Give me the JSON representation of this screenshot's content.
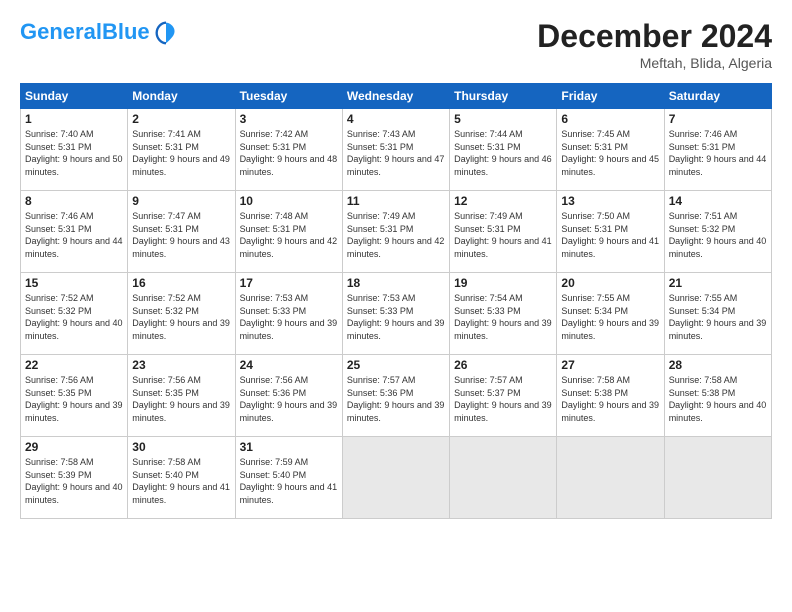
{
  "header": {
    "logo_text_general": "General",
    "logo_text_blue": "Blue",
    "month_title": "December 2024",
    "location": "Meftah, Blida, Algeria"
  },
  "weekdays": [
    "Sunday",
    "Monday",
    "Tuesday",
    "Wednesday",
    "Thursday",
    "Friday",
    "Saturday"
  ],
  "weeks": [
    [
      {
        "day": 1,
        "sunrise": "7:40 AM",
        "sunset": "5:31 PM",
        "daylight": "9 hours and 50 minutes."
      },
      {
        "day": 2,
        "sunrise": "7:41 AM",
        "sunset": "5:31 PM",
        "daylight": "9 hours and 49 minutes."
      },
      {
        "day": 3,
        "sunrise": "7:42 AM",
        "sunset": "5:31 PM",
        "daylight": "9 hours and 48 minutes."
      },
      {
        "day": 4,
        "sunrise": "7:43 AM",
        "sunset": "5:31 PM",
        "daylight": "9 hours and 47 minutes."
      },
      {
        "day": 5,
        "sunrise": "7:44 AM",
        "sunset": "5:31 PM",
        "daylight": "9 hours and 46 minutes."
      },
      {
        "day": 6,
        "sunrise": "7:45 AM",
        "sunset": "5:31 PM",
        "daylight": "9 hours and 45 minutes."
      },
      {
        "day": 7,
        "sunrise": "7:46 AM",
        "sunset": "5:31 PM",
        "daylight": "9 hours and 44 minutes."
      }
    ],
    [
      {
        "day": 8,
        "sunrise": "7:46 AM",
        "sunset": "5:31 PM",
        "daylight": "9 hours and 44 minutes."
      },
      {
        "day": 9,
        "sunrise": "7:47 AM",
        "sunset": "5:31 PM",
        "daylight": "9 hours and 43 minutes."
      },
      {
        "day": 10,
        "sunrise": "7:48 AM",
        "sunset": "5:31 PM",
        "daylight": "9 hours and 42 minutes."
      },
      {
        "day": 11,
        "sunrise": "7:49 AM",
        "sunset": "5:31 PM",
        "daylight": "9 hours and 42 minutes."
      },
      {
        "day": 12,
        "sunrise": "7:49 AM",
        "sunset": "5:31 PM",
        "daylight": "9 hours and 41 minutes."
      },
      {
        "day": 13,
        "sunrise": "7:50 AM",
        "sunset": "5:31 PM",
        "daylight": "9 hours and 41 minutes."
      },
      {
        "day": 14,
        "sunrise": "7:51 AM",
        "sunset": "5:32 PM",
        "daylight": "9 hours and 40 minutes."
      }
    ],
    [
      {
        "day": 15,
        "sunrise": "7:52 AM",
        "sunset": "5:32 PM",
        "daylight": "9 hours and 40 minutes."
      },
      {
        "day": 16,
        "sunrise": "7:52 AM",
        "sunset": "5:32 PM",
        "daylight": "9 hours and 39 minutes."
      },
      {
        "day": 17,
        "sunrise": "7:53 AM",
        "sunset": "5:33 PM",
        "daylight": "9 hours and 39 minutes."
      },
      {
        "day": 18,
        "sunrise": "7:53 AM",
        "sunset": "5:33 PM",
        "daylight": "9 hours and 39 minutes."
      },
      {
        "day": 19,
        "sunrise": "7:54 AM",
        "sunset": "5:33 PM",
        "daylight": "9 hours and 39 minutes."
      },
      {
        "day": 20,
        "sunrise": "7:55 AM",
        "sunset": "5:34 PM",
        "daylight": "9 hours and 39 minutes."
      },
      {
        "day": 21,
        "sunrise": "7:55 AM",
        "sunset": "5:34 PM",
        "daylight": "9 hours and 39 minutes."
      }
    ],
    [
      {
        "day": 22,
        "sunrise": "7:56 AM",
        "sunset": "5:35 PM",
        "daylight": "9 hours and 39 minutes."
      },
      {
        "day": 23,
        "sunrise": "7:56 AM",
        "sunset": "5:35 PM",
        "daylight": "9 hours and 39 minutes."
      },
      {
        "day": 24,
        "sunrise": "7:56 AM",
        "sunset": "5:36 PM",
        "daylight": "9 hours and 39 minutes."
      },
      {
        "day": 25,
        "sunrise": "7:57 AM",
        "sunset": "5:36 PM",
        "daylight": "9 hours and 39 minutes."
      },
      {
        "day": 26,
        "sunrise": "7:57 AM",
        "sunset": "5:37 PM",
        "daylight": "9 hours and 39 minutes."
      },
      {
        "day": 27,
        "sunrise": "7:58 AM",
        "sunset": "5:38 PM",
        "daylight": "9 hours and 39 minutes."
      },
      {
        "day": 28,
        "sunrise": "7:58 AM",
        "sunset": "5:38 PM",
        "daylight": "9 hours and 40 minutes."
      }
    ],
    [
      {
        "day": 29,
        "sunrise": "7:58 AM",
        "sunset": "5:39 PM",
        "daylight": "9 hours and 40 minutes."
      },
      {
        "day": 30,
        "sunrise": "7:58 AM",
        "sunset": "5:40 PM",
        "daylight": "9 hours and 41 minutes."
      },
      {
        "day": 31,
        "sunrise": "7:59 AM",
        "sunset": "5:40 PM",
        "daylight": "9 hours and 41 minutes."
      },
      null,
      null,
      null,
      null
    ]
  ]
}
